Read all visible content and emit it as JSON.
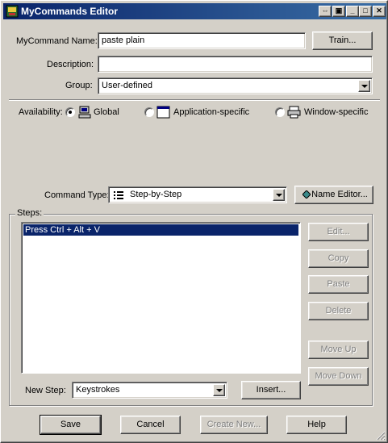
{
  "window": {
    "title": "MyCommands Editor",
    "accent_color": "#0a246a",
    "controls": [
      "pin-icon",
      "restore-icon",
      "minimize-icon",
      "maximize-icon",
      "close-icon"
    ]
  },
  "form": {
    "name_label": "MyCommand Name:",
    "name_value": "paste plain",
    "train_button": "Train...",
    "description_label": "Description:",
    "description_value": "",
    "group_label": "Group:",
    "group_value": "User-defined"
  },
  "availability": {
    "label": "Availability:",
    "options": [
      {
        "label": "Global",
        "icon": "computer-icon",
        "checked": true
      },
      {
        "label": "Application-specific",
        "icon": "window-icon",
        "checked": false
      },
      {
        "label": "Window-specific",
        "icon": "printer-window-icon",
        "checked": false
      }
    ]
  },
  "command_type": {
    "label": "Command Type:",
    "value": "Step-by-Step",
    "name_editor_button": "Name Editor..."
  },
  "steps": {
    "group_label": "Steps:",
    "items": [
      "Press Ctrl + Alt + V"
    ],
    "buttons": {
      "edit": "Edit...",
      "copy": "Copy",
      "paste": "Paste",
      "delete": "Delete",
      "move_up": "Move Up",
      "move_down": "Move Down"
    },
    "new_step_label": "New Step:",
    "new_step_value": "Keystrokes",
    "insert_button": "Insert..."
  },
  "footer": {
    "save": "Save",
    "cancel": "Cancel",
    "create_new": "Create New...",
    "help": "Help"
  }
}
